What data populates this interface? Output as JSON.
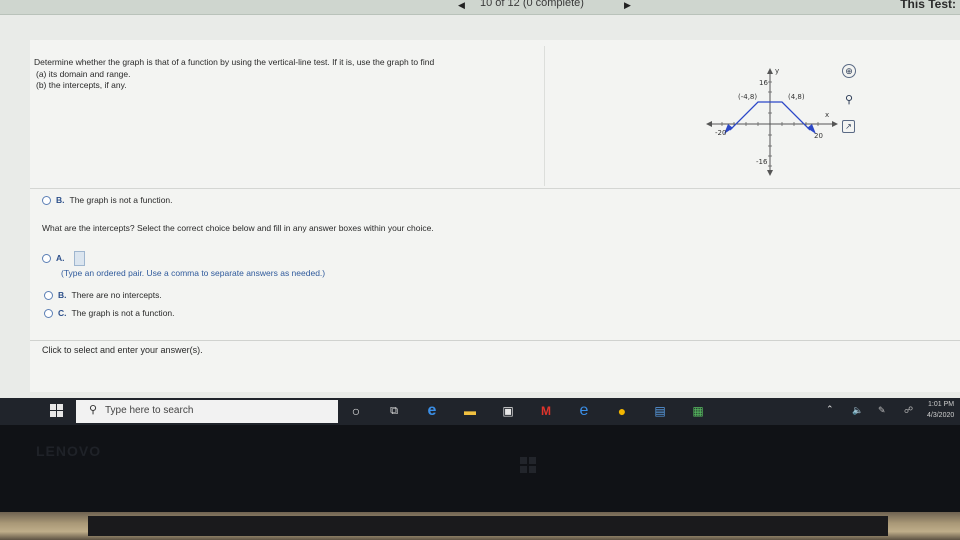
{
  "window": {
    "progress_text": "10 of 12 (0 complete)",
    "test_title": "This Test:"
  },
  "question": {
    "line1": "Determine whether the graph is that of a function by using the vertical-line test. If it is, use the graph to find",
    "line2": "(a) its domain and range.",
    "line3": "(b) the intercepts, if any."
  },
  "graph": {
    "y_axis_label": "y",
    "x_axis_label": "x",
    "y_top_tick": "16",
    "y_bottom_tick": "-16",
    "x_left_tick": "-20",
    "x_right_tick": "20",
    "point_left": "(-4,8)",
    "point_right": "(4,8)",
    "accent_color": "#2c48c8",
    "tools": [
      "zoom-in-icon",
      "zoom-out-icon",
      "popout-icon"
    ]
  },
  "prev_answer": {
    "letter": "B.",
    "text": "The graph is not a function."
  },
  "intercepts": {
    "prompt": "What are the intercepts? Select the correct choice below and fill in any answer boxes within your choice.",
    "option_a_letter": "A.",
    "option_a_hint": "(Type an ordered pair. Use a comma to separate answers as needed.)",
    "option_b_letter": "B.",
    "option_b_text": "There are no intercepts.",
    "option_c_letter": "C.",
    "option_c_text": "The graph is not a function."
  },
  "footer": {
    "instruction": "Click to select and enter your answer(s)."
  },
  "taskbar": {
    "search_placeholder": "Type here to search",
    "clock_time": "1:01 PM",
    "clock_date": "4/3/2020"
  },
  "bezel": {
    "brand": "LENOVO"
  }
}
